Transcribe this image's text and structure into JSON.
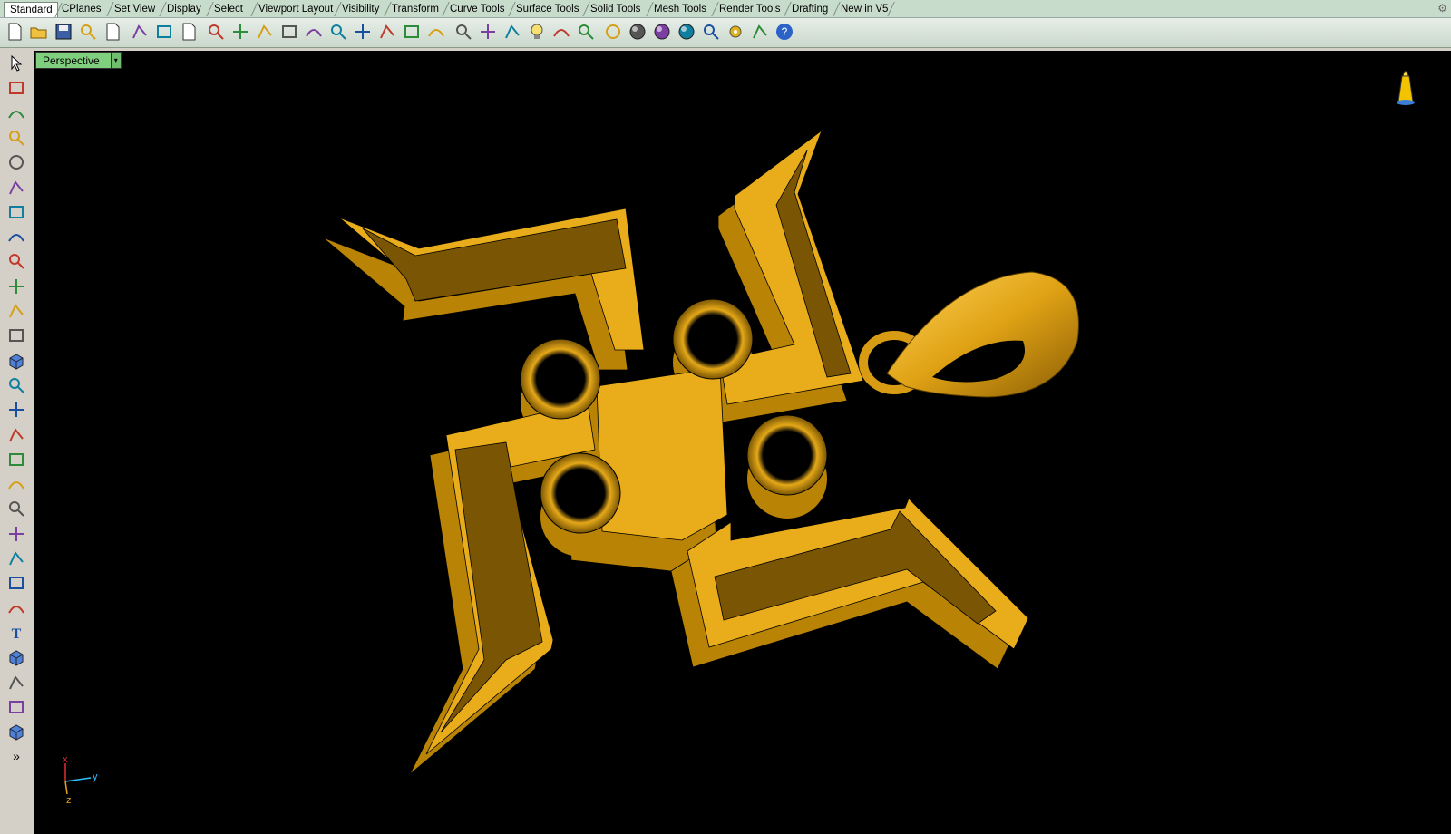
{
  "tabs": [
    "Standard",
    "CPlanes",
    "Set View",
    "Display",
    "Select",
    "Viewport Layout",
    "Visibility",
    "Transform",
    "Curve Tools",
    "Surface Tools",
    "Solid Tools",
    "Mesh Tools",
    "Render Tools",
    "Drafting",
    "New in V5"
  ],
  "active_tab": "Standard",
  "toolbar_icons": [
    "new-icon",
    "open-icon",
    "save-icon",
    "print-icon",
    "import-icon",
    "cut-icon",
    "copy-icon",
    "paste-icon",
    "undo-icon",
    "pan-icon",
    "move-icon",
    "zoom-icon",
    "zoom-window-icon",
    "zoom-extents-icon",
    "zoom-selected-icon",
    "rotate-view-icon",
    "four-viewports-icon",
    "car-icon",
    "hide-icon",
    "show-icon",
    "select-icon",
    "light-icon",
    "lock-icon",
    "layer-icon",
    "color-wheel-icon",
    "shaded-sphere-icon",
    "rendered-sphere-icon",
    "render-sphere-icon",
    "flag-icon",
    "gear-icon",
    "dimension-icon",
    "help-icon"
  ],
  "left_tools": [
    "arrow-select-icon",
    "point-icon",
    "polyline-icon",
    "curve-icon",
    "circle-icon",
    "ellipse-icon",
    "arc-icon",
    "rectangle-icon",
    "polygon-icon",
    "fillet-icon",
    "surface-icon",
    "surface-from-curves-icon",
    "box-icon",
    "solid-union-icon",
    "cylinder-surface-icon",
    "mesh-icon",
    "transform-icon",
    "analyze-icon",
    "dimension-tool-icon",
    "boolean-icon",
    "points-icon",
    "curve-edit-icon",
    "fillet-curves-icon",
    "text-icon",
    "extrude-icon",
    "group-icon",
    "block-icon",
    "render-icon",
    "more-tools-icon"
  ],
  "viewport": {
    "title": "Perspective",
    "menu_arrow": "▾",
    "axis": {
      "x": "x",
      "y": "y",
      "z": "z"
    }
  },
  "more_glyph": "»",
  "colors": {
    "viewport_bg": "#000000",
    "gold_top": "#e9ac1b",
    "gold_side": "#b98305",
    "gold_dark": "#7a5604",
    "tab_bar": "#c8dccb",
    "viewport_tab": "#7fcf7f"
  }
}
